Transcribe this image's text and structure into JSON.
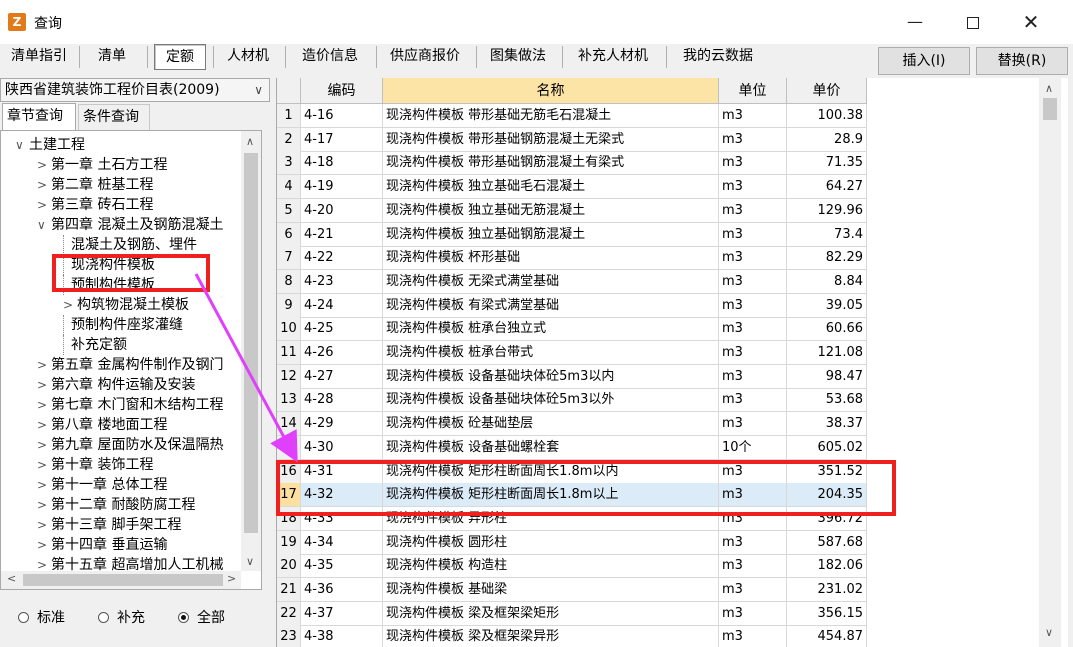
{
  "window": {
    "title": "查询",
    "icon": "app-icon"
  },
  "tabs": [
    "清单指引",
    "清单",
    "定额",
    "人材机",
    "造价信息",
    "供应商报价",
    "图集做法",
    "补充人材机",
    "我的云数据"
  ],
  "active_tab": "定额",
  "actions": {
    "insert": "插入(I)",
    "replace": "替换(R)"
  },
  "left": {
    "combo_value": "陕西省建筑装饰工程价目表(2009)",
    "tab_chapter": "章节查询",
    "tab_condition": "条件查询",
    "tree": [
      {
        "label": "土建工程",
        "toggle": "∨",
        "level": 0
      },
      {
        "label": "第一章 土石方工程",
        "toggle": ">",
        "level": 1
      },
      {
        "label": "第二章 桩基工程",
        "toggle": ">",
        "level": 1
      },
      {
        "label": "第三章 砖石工程",
        "toggle": ">",
        "level": 1
      },
      {
        "label": "第四章 混凝土及钢筋混凝土",
        "toggle": "∨",
        "level": 1
      },
      {
        "label": "混凝土及钢筋、埋件",
        "toggle": "",
        "level": 2
      },
      {
        "label": "现浇构件模板",
        "toggle": "",
        "level": 2
      },
      {
        "label": "预制构件模板",
        "toggle": "",
        "level": 2
      },
      {
        "label": "构筑物混凝土模板",
        "toggle": ">",
        "level": 2
      },
      {
        "label": "预制构件座浆灌缝",
        "toggle": "",
        "level": 2
      },
      {
        "label": "补充定额",
        "toggle": "",
        "level": 2
      },
      {
        "label": "第五章 金属构件制作及钢门",
        "toggle": ">",
        "level": 1
      },
      {
        "label": "第六章 构件运输及安装",
        "toggle": ">",
        "level": 1
      },
      {
        "label": "第七章 木门窗和木结构工程",
        "toggle": ">",
        "level": 1
      },
      {
        "label": "第八章 楼地面工程",
        "toggle": ">",
        "level": 1
      },
      {
        "label": "第九章 屋面防水及保温隔热",
        "toggle": ">",
        "level": 1
      },
      {
        "label": "第十章 装饰工程",
        "toggle": ">",
        "level": 1
      },
      {
        "label": "第十一章 总体工程",
        "toggle": ">",
        "level": 1
      },
      {
        "label": "第十二章 耐酸防腐工程",
        "toggle": ">",
        "level": 1
      },
      {
        "label": "第十三章 脚手架工程",
        "toggle": ">",
        "level": 1
      },
      {
        "label": "第十四章 垂直运输",
        "toggle": ">",
        "level": 1
      },
      {
        "label": "第十五章 超高增加人工机械",
        "toggle": ">",
        "level": 1
      }
    ],
    "radios": [
      {
        "label": "标准",
        "selected": false
      },
      {
        "label": "补充",
        "selected": false
      },
      {
        "label": "全部",
        "selected": true
      }
    ]
  },
  "grid": {
    "headers": [
      "",
      "编码",
      "名称",
      "单位",
      "单价"
    ],
    "selected_row": 17,
    "rows": [
      {
        "idx": "1",
        "code": "4-16",
        "name": "现浇构件模板 带形基础无筋毛石混凝土",
        "unit": "m3",
        "price": "100.38"
      },
      {
        "idx": "2",
        "code": "4-17",
        "name": "现浇构件模板 带形基础钢筋混凝土无梁式",
        "unit": "m3",
        "price": "28.9"
      },
      {
        "idx": "3",
        "code": "4-18",
        "name": "现浇构件模板 带形基础钢筋混凝土有梁式",
        "unit": "m3",
        "price": "71.35"
      },
      {
        "idx": "4",
        "code": "4-19",
        "name": "现浇构件模板 独立基础毛石混凝土",
        "unit": "m3",
        "price": "64.27"
      },
      {
        "idx": "5",
        "code": "4-20",
        "name": "现浇构件模板 独立基础无筋混凝土",
        "unit": "m3",
        "price": "129.96"
      },
      {
        "idx": "6",
        "code": "4-21",
        "name": "现浇构件模板 独立基础钢筋混凝土",
        "unit": "m3",
        "price": "73.4"
      },
      {
        "idx": "7",
        "code": "4-22",
        "name": "现浇构件模板 杯形基础",
        "unit": "m3",
        "price": "82.29"
      },
      {
        "idx": "8",
        "code": "4-23",
        "name": "现浇构件模板 无梁式满堂基础",
        "unit": "m3",
        "price": "8.84"
      },
      {
        "idx": "9",
        "code": "4-24",
        "name": "现浇构件模板 有梁式满堂基础",
        "unit": "m3",
        "price": "39.05"
      },
      {
        "idx": "10",
        "code": "4-25",
        "name": "现浇构件模板 桩承台独立式",
        "unit": "m3",
        "price": "60.66"
      },
      {
        "idx": "11",
        "code": "4-26",
        "name": "现浇构件模板 桩承台带式",
        "unit": "m3",
        "price": "121.08"
      },
      {
        "idx": "12",
        "code": "4-27",
        "name": "现浇构件模板 设备基础块体砼5m3以内",
        "unit": "m3",
        "price": "98.47"
      },
      {
        "idx": "13",
        "code": "4-28",
        "name": "现浇构件模板 设备基础块体砼5m3以外",
        "unit": "m3",
        "price": "53.68"
      },
      {
        "idx": "14",
        "code": "4-29",
        "name": "现浇构件模板 砼基础垫层",
        "unit": "m3",
        "price": "38.37"
      },
      {
        "idx": "15",
        "code": "4-30",
        "name": "现浇构件模板 设备基础螺栓套",
        "unit": "10个",
        "price": "605.02"
      },
      {
        "idx": "16",
        "code": "4-31",
        "name": "现浇构件模板 矩形柱断面周长1.8m以内",
        "unit": "m3",
        "price": "351.52"
      },
      {
        "idx": "17",
        "code": "4-32",
        "name": "现浇构件模板 矩形柱断面周长1.8m以上",
        "unit": "m3",
        "price": "204.35"
      },
      {
        "idx": "18",
        "code": "4-33",
        "name": "现浇构件模板 异形柱",
        "unit": "m3",
        "price": "396.72"
      },
      {
        "idx": "19",
        "code": "4-34",
        "name": "现浇构件模板 圆形柱",
        "unit": "m3",
        "price": "587.68"
      },
      {
        "idx": "20",
        "code": "4-35",
        "name": "现浇构件模板 构造柱",
        "unit": "m3",
        "price": "182.06"
      },
      {
        "idx": "21",
        "code": "4-36",
        "name": "现浇构件模板 基础梁",
        "unit": "m3",
        "price": "231.02"
      },
      {
        "idx": "22",
        "code": "4-37",
        "name": "现浇构件模板 梁及框架梁矩形",
        "unit": "m3",
        "price": "356.15"
      },
      {
        "idx": "23",
        "code": "4-38",
        "name": "现浇构件模板 梁及框架梁异形",
        "unit": "m3",
        "price": "454.87"
      }
    ]
  },
  "annotation_color": "#ee2020",
  "arrow_color": "#e040fb"
}
